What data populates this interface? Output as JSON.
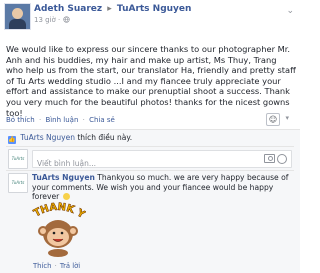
{
  "post": {
    "author": "Adeth Suarez",
    "arrow": "▸",
    "target": "TuArts Nguyen",
    "time": "13 giờ",
    "privacy_icon": "globe-icon",
    "text": "We would like to express our sincere thanks to our photographer Mr. Anh and his buddies, my hair and make up artist, Ms Thuy, Trang who help us from the start, our translator Ha, friendly and pretty staff of Tu Arts wedding studio ...I and my fiancee truly appreciate your effort and assistance to make our prenuptial shoot a success. Thank you very much for the beautiful photos! thanks for the nicest gowns too!"
  },
  "actions": {
    "like": "Bỏ thích",
    "comment": "Bình luận",
    "share": "Chia sẻ",
    "separator": "·"
  },
  "feedback": {
    "liker": "TuArts Nguyen",
    "like_text": " thích điều này."
  },
  "composer": {
    "placeholder": "Viết bình luận..."
  },
  "comment": {
    "author": "TuArts Nguyen",
    "text": " Thankyou so much. we are very happy because of your comments. We wish you and your fiancee would be happy forever",
    "sticker_text": "THANK You",
    "like": "Thích",
    "reply": "Trả lời",
    "separator": "·"
  },
  "colors": {
    "link": "#3b5998",
    "feedback_bg": "#f6f7f9",
    "like_blue": "#5890ff"
  }
}
